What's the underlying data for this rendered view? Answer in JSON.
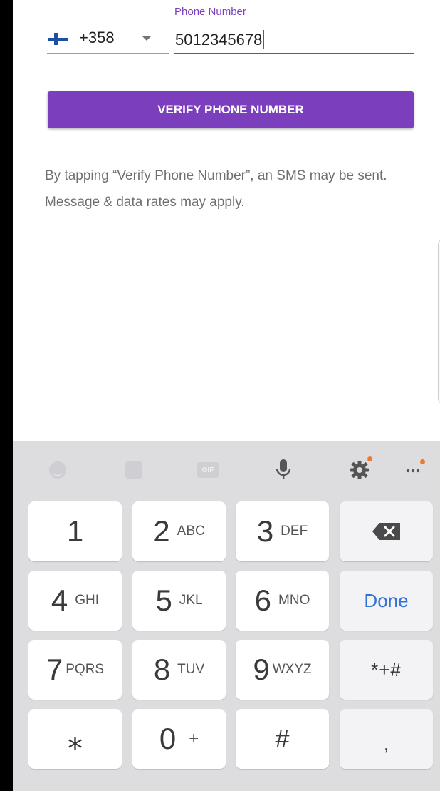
{
  "form": {
    "country_code": "+358",
    "country_flag": "finland-flag",
    "phone_label": "Phone Number",
    "phone_value": "5012345678",
    "verify_button": "VERIFY PHONE NUMBER",
    "terms_text": "By tapping “Verify Phone Number”, an SMS may be sent. Message & data rates may apply."
  },
  "colors": {
    "accent": "#7b3fbd",
    "done": "#3370d8",
    "notification_dot": "#f4782d"
  },
  "keyboard": {
    "toolbar": [
      "emoji-icon",
      "sticker-icon",
      "gif-icon",
      "mic-icon",
      "settings-icon",
      "more-icon"
    ],
    "gif_label": "GIF",
    "keys": [
      {
        "num": "1",
        "sub": ""
      },
      {
        "num": "2",
        "sub": "ABC"
      },
      {
        "num": "3",
        "sub": "DEF"
      },
      {
        "num": "4",
        "sub": "GHI"
      },
      {
        "num": "5",
        "sub": "JKL"
      },
      {
        "num": "6",
        "sub": "MNO"
      },
      {
        "num": "7",
        "sub": "PQRS"
      },
      {
        "num": "8",
        "sub": "TUV"
      },
      {
        "num": "9",
        "sub": "WXYZ"
      },
      {
        "num": "⁎",
        "sub": ""
      },
      {
        "num": "0",
        "sub": "+"
      },
      {
        "num": "#",
        "sub": ""
      }
    ],
    "done_label": "Done",
    "symbols_label": "*+#",
    "comma_label": ","
  }
}
